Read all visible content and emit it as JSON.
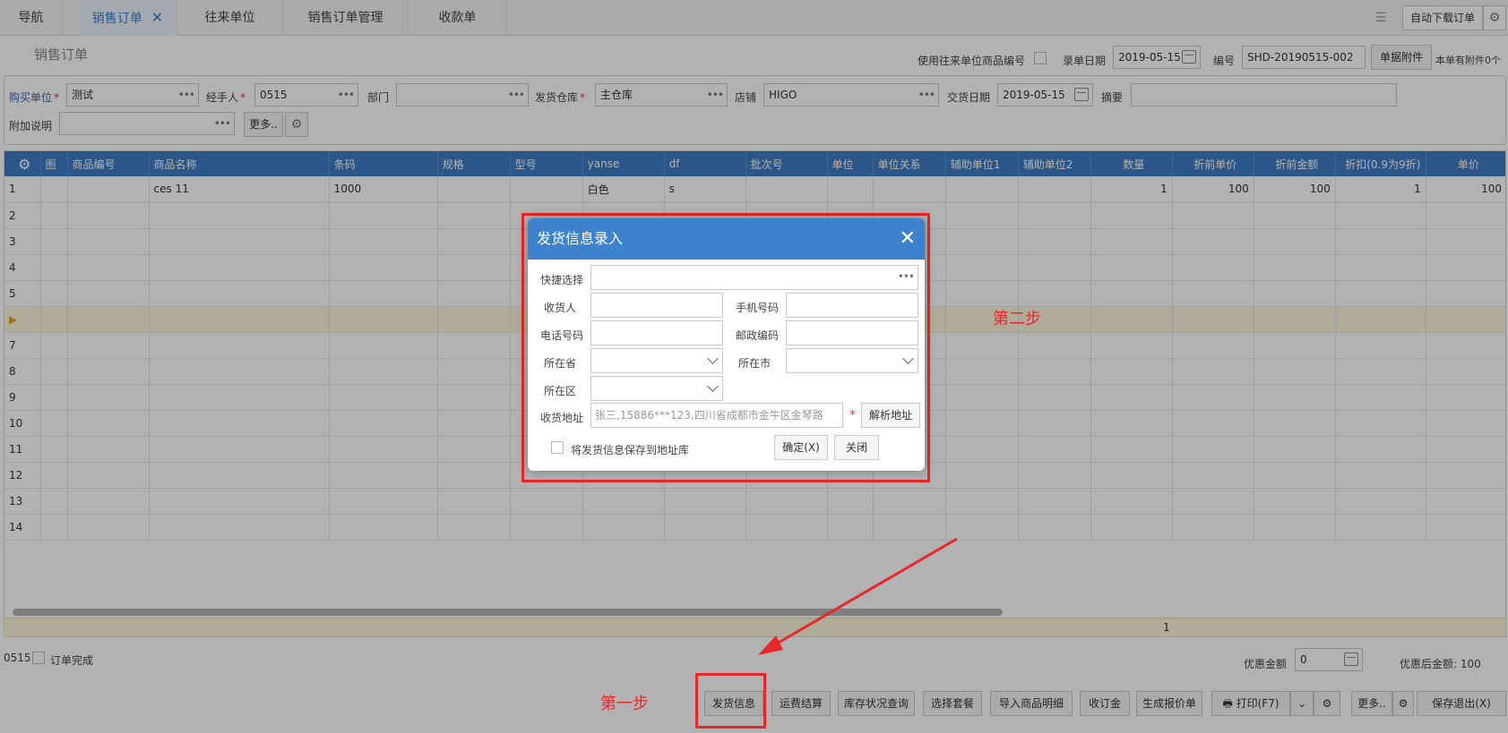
{
  "tabs": [
    {
      "label": "导航"
    },
    {
      "label": "销售订单"
    },
    {
      "label": "往来单位"
    },
    {
      "label": "销售订单管理"
    },
    {
      "label": "收款单"
    }
  ],
  "tab_close": "✕",
  "toolbar_right": {
    "auto_download": "自动下载订单"
  },
  "page_title": "销售订单",
  "header": {
    "use_partner_code_label": "使用往来单位商品编号",
    "entry_date_label": "录单日期",
    "entry_date": "2019-05-15",
    "number_label": "编号",
    "number": "SHD-20190515-002",
    "attachment_button": "单据附件",
    "attachment_info": "本单有附件0个"
  },
  "form": {
    "buyer_label": "购买单位",
    "buyer_value": "测试",
    "handler_label": "经手人",
    "handler_value": "0515",
    "dept_label": "部门",
    "dept_value": "",
    "warehouse_label": "发货仓库",
    "warehouse_value": "主仓库",
    "shop_label": "店铺",
    "shop_value": "HIGO",
    "delivery_date_label": "交货日期",
    "delivery_date_value": "2019-05-15",
    "summary_label": "摘要",
    "summary_value": "",
    "extra_note_label": "附加说明",
    "extra_note_value": "",
    "more_button": "更多.."
  },
  "grid": {
    "columns": [
      "图",
      "商品编号",
      "商品名称",
      "条码",
      "规格",
      "型号",
      "yanse",
      "df",
      "批次号",
      "单位",
      "单位关系",
      "辅助单位1",
      "辅助单位2",
      "数量",
      "折前单价",
      "折前金额",
      "折扣(0.9为9折)",
      "单价"
    ],
    "rows": [
      {
        "no": "1",
        "cells": [
          "",
          "",
          "ces 11",
          "1000",
          "",
          "",
          "白色",
          "s",
          "",
          "",
          "",
          "",
          "",
          "1",
          "100",
          "100",
          "1",
          "100"
        ]
      },
      {
        "no": "2",
        "cells": [
          "",
          "",
          "",
          "",
          "",
          "",
          "",
          "",
          "",
          "",
          "",
          "",
          "",
          "",
          "",
          "",
          "",
          ""
        ]
      },
      {
        "no": "3",
        "cells": [
          "",
          "",
          "",
          "",
          "",
          "",
          "",
          "",
          "",
          "",
          "",
          "",
          "",
          "",
          "",
          "",
          "",
          ""
        ]
      },
      {
        "no": "4",
        "cells": [
          "",
          "",
          "",
          "",
          "",
          "",
          "",
          "",
          "",
          "",
          "",
          "",
          "",
          "",
          "",
          "",
          "",
          ""
        ]
      },
      {
        "no": "5",
        "cells": [
          "",
          "",
          "",
          "",
          "",
          "",
          "",
          "",
          "",
          "",
          "",
          "",
          "",
          "",
          "",
          "",
          "",
          ""
        ]
      },
      {
        "no": "▶",
        "cells": [
          "",
          "",
          "",
          "",
          "",
          "",
          "",
          "",
          "",
          "",
          "",
          "",
          "",
          "",
          "",
          "",
          "",
          ""
        ]
      },
      {
        "no": "7",
        "cells": [
          "",
          "",
          "",
          "",
          "",
          "",
          "",
          "",
          "",
          "",
          "",
          "",
          "",
          "",
          "",
          "",
          "",
          ""
        ]
      },
      {
        "no": "8",
        "cells": [
          "",
          "",
          "",
          "",
          "",
          "",
          "",
          "",
          "",
          "",
          "",
          "",
          "",
          "",
          "",
          "",
          "",
          ""
        ]
      },
      {
        "no": "9",
        "cells": [
          "",
          "",
          "",
          "",
          "",
          "",
          "",
          "",
          "",
          "",
          "",
          "",
          "",
          "",
          "",
          "",
          "",
          ""
        ]
      },
      {
        "no": "10",
        "cells": [
          "",
          "",
          "",
          "",
          "",
          "",
          "",
          "",
          "",
          "",
          "",
          "",
          "",
          "",
          "",
          "",
          "",
          ""
        ]
      },
      {
        "no": "11",
        "cells": [
          "",
          "",
          "",
          "",
          "",
          "",
          "",
          "",
          "",
          "",
          "",
          "",
          "",
          "",
          "",
          "",
          "",
          ""
        ]
      },
      {
        "no": "12",
        "cells": [
          "",
          "",
          "",
          "",
          "",
          "",
          "",
          "",
          "",
          "",
          "",
          "",
          "",
          "",
          "",
          "",
          "",
          ""
        ]
      },
      {
        "no": "13",
        "cells": [
          "",
          "",
          "",
          "",
          "",
          "",
          "",
          "",
          "",
          "",
          "",
          "",
          "",
          "",
          "",
          "",
          "",
          ""
        ]
      },
      {
        "no": "14",
        "cells": [
          "",
          "",
          "",
          "",
          "",
          "",
          "",
          "",
          "",
          "",
          "",
          "",
          "",
          "",
          "",
          "",
          "",
          ""
        ]
      }
    ],
    "sum_quantity": "1"
  },
  "footer": {
    "handler_code": "0515",
    "order_done_label": "订单完成",
    "discount_amount_label": "优惠金额",
    "discount_amount_value": "0",
    "after_discount_label": "优惠后金额:",
    "after_discount_value": "100",
    "buttons": {
      "shipping_info": "发货信息",
      "freight_settle": "运费结算",
      "stock_query": "库存状况查询",
      "select_bundle": "选择套餐",
      "import_detail": "导入商品明细",
      "deposit": "收订金",
      "gen_quote": "生成报价单",
      "print": "打印(F7)",
      "more": "更多..",
      "save_exit": "保存退出(X)"
    }
  },
  "annotations": {
    "step1": "第一步",
    "step2": "第二步"
  },
  "dialog": {
    "title": "发货信息录入",
    "quick_select_label": "快捷选择",
    "receiver_label": "收货人",
    "mobile_label": "手机号码",
    "phone_label": "电话号码",
    "postcode_label": "邮政编码",
    "province_label": "所在省",
    "city_label": "所在市",
    "district_label": "所在区",
    "address_label": "收货地址",
    "address_placeholder": "张三,15886***123,四川省成都市金牛区金琴路",
    "parse_button": "解析地址",
    "save_to_book_label": "将发货信息保存到地址库",
    "ok_button": "确定(X)",
    "close_button": "关闭"
  },
  "colors": {
    "header_blue": "#3d7cc4",
    "annotation_red": "#e8272b",
    "current_row": "#fdf6dc"
  }
}
